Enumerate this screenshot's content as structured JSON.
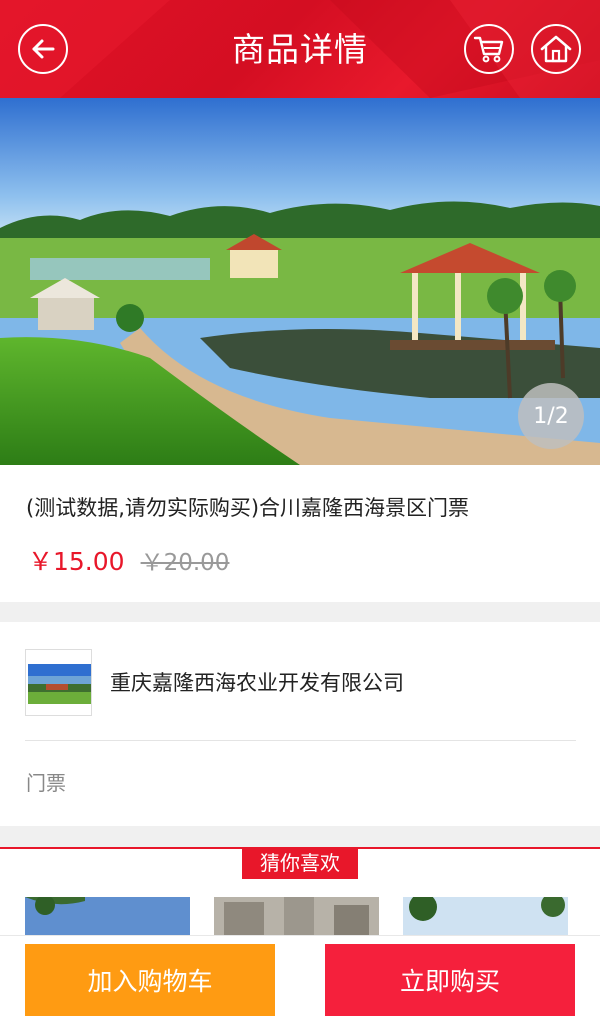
{
  "header": {
    "title": "商品详情",
    "back_icon": "back-arrow-icon",
    "cart_icon": "cart-icon",
    "home_icon": "home-icon",
    "color": "#e01227"
  },
  "gallery": {
    "pager": "1/2",
    "current_index": 1,
    "total": 2
  },
  "product": {
    "title": "(测试数据,请勿实际购买)合川嘉隆西海景区门票",
    "price": "￥15.00",
    "original_price": "￥20.00",
    "category": "门票"
  },
  "shop": {
    "name": "重庆嘉隆西海农业开发有限公司"
  },
  "recommend": {
    "label": "猜你喜欢"
  },
  "actions": {
    "add_to_cart": "加入购物车",
    "buy_now": "立即购买"
  },
  "colors": {
    "accent_red": "#e8172a",
    "cart_orange": "#ff9b12",
    "buy_red": "#f5203c"
  }
}
